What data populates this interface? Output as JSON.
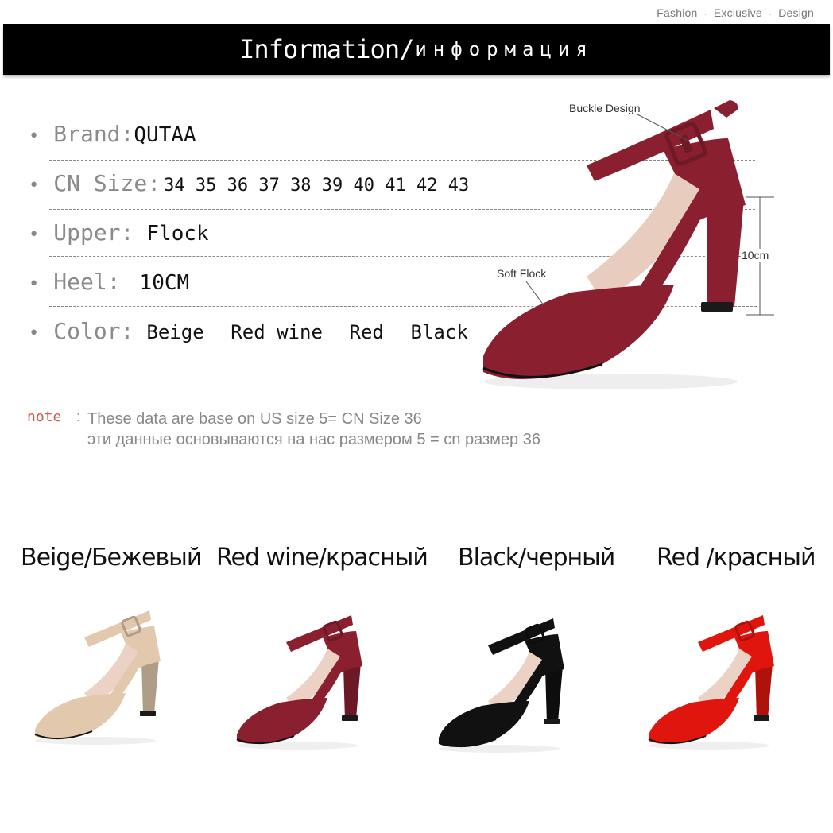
{
  "header": {
    "tagline_parts": [
      "Fashion",
      "Exclusive",
      "Design"
    ],
    "tagline_sep": "·",
    "title_en": "Information/",
    "title_ru": "информация"
  },
  "specs": {
    "bullet": "•",
    "brand": {
      "key": "Brand",
      "sep": ":",
      "value": "QUTAA"
    },
    "size": {
      "key": "CN Size",
      "sep": ":",
      "value": "34 35 36 37 38 39 40 41 42 43"
    },
    "upper": {
      "key": "Upper",
      "sep": ":",
      "value": "Flock"
    },
    "heel": {
      "key": "Heel",
      "sep": ":",
      "value": "10CM"
    },
    "color": {
      "key": "Color",
      "sep": ":",
      "values": [
        "Beige",
        "Red wine",
        "Red",
        "Black"
      ]
    }
  },
  "annotations": {
    "buckle": "Buckle Design",
    "flock": "Soft Flock",
    "height": "10cm"
  },
  "note": {
    "label": "note",
    "sep": ":",
    "line1": "These data are base on US size 5= CN Size 36",
    "line2": "эти данные основываются на нас размером 5 = cn размер 36"
  },
  "variants": [
    {
      "label": "Beige/Бежевый",
      "color": "#e2c9ad"
    },
    {
      "label": "Red wine/красный",
      "color": "#8a1f30"
    },
    {
      "label": "Black/черный",
      "color": "#111111"
    },
    {
      "label": "Red /красный",
      "color": "#e0160e"
    }
  ],
  "colors": {
    "hero_shoe": "#8a1f30",
    "banner": "#000000",
    "note_label": "#d4574d"
  }
}
